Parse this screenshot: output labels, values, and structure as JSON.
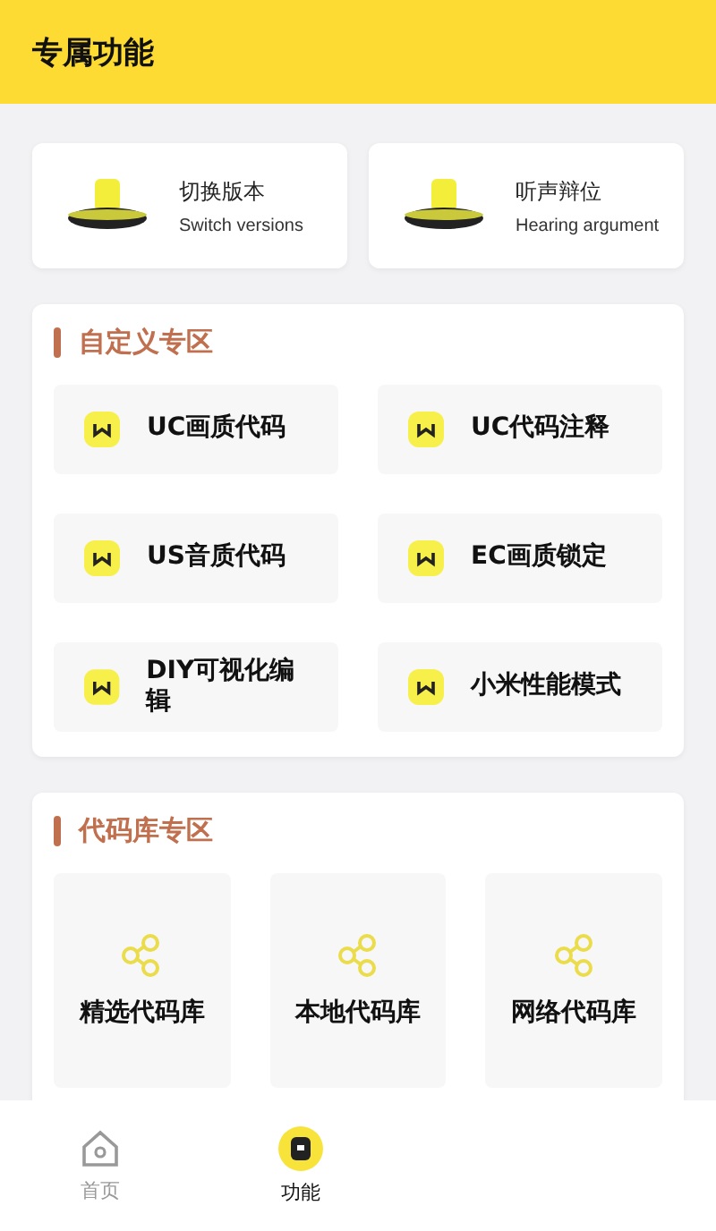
{
  "header": {
    "title": "专属功能"
  },
  "quick_cards": [
    {
      "title": "切换版本",
      "subtitle": "Switch versions"
    },
    {
      "title": "听声辩位",
      "subtitle": "Hearing argument"
    }
  ],
  "sections": [
    {
      "title": "自定义专区",
      "kind": "grid",
      "items": [
        {
          "label": "UC画质代码"
        },
        {
          "label": "UC代码注释"
        },
        {
          "label": "US音质代码"
        },
        {
          "label": "EC画质锁定"
        },
        {
          "label": "DIY可视化编辑"
        },
        {
          "label": "小米性能模式"
        }
      ]
    },
    {
      "title": "代码库专区",
      "kind": "library",
      "items": [
        {
          "label": "精选代码库"
        },
        {
          "label": "本地代码库"
        },
        {
          "label": "网络代码库"
        }
      ]
    }
  ],
  "tab_bar": [
    {
      "label": "首页",
      "kind": "home",
      "selected": false
    },
    {
      "label": "功能",
      "kind": "feature",
      "selected": true
    }
  ]
}
